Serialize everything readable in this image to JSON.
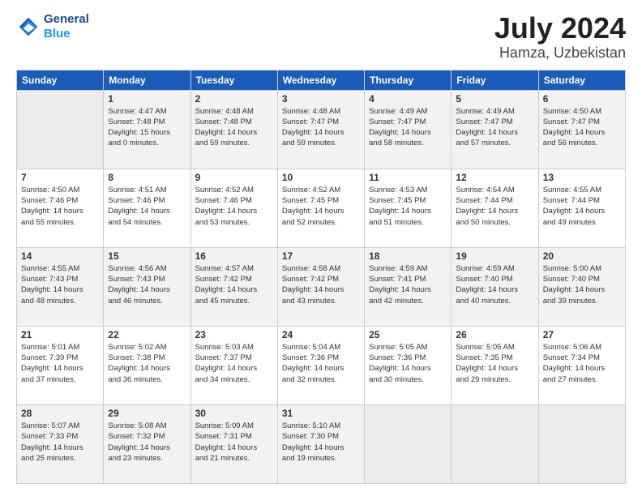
{
  "header": {
    "logo_line1": "General",
    "logo_line2": "Blue",
    "month": "July 2024",
    "location": "Hamza, Uzbekistan"
  },
  "weekdays": [
    "Sunday",
    "Monday",
    "Tuesday",
    "Wednesday",
    "Thursday",
    "Friday",
    "Saturday"
  ],
  "rows": [
    [
      {
        "day": "",
        "info": ""
      },
      {
        "day": "1",
        "info": "Sunrise: 4:47 AM\nSunset: 7:48 PM\nDaylight: 15 hours\nand 0 minutes."
      },
      {
        "day": "2",
        "info": "Sunrise: 4:48 AM\nSunset: 7:48 PM\nDaylight: 14 hours\nand 59 minutes."
      },
      {
        "day": "3",
        "info": "Sunrise: 4:48 AM\nSunset: 7:47 PM\nDaylight: 14 hours\nand 59 minutes."
      },
      {
        "day": "4",
        "info": "Sunrise: 4:49 AM\nSunset: 7:47 PM\nDaylight: 14 hours\nand 58 minutes."
      },
      {
        "day": "5",
        "info": "Sunrise: 4:49 AM\nSunset: 7:47 PM\nDaylight: 14 hours\nand 57 minutes."
      },
      {
        "day": "6",
        "info": "Sunrise: 4:50 AM\nSunset: 7:47 PM\nDaylight: 14 hours\nand 56 minutes."
      }
    ],
    [
      {
        "day": "7",
        "info": "Sunrise: 4:50 AM\nSunset: 7:46 PM\nDaylight: 14 hours\nand 55 minutes."
      },
      {
        "day": "8",
        "info": "Sunrise: 4:51 AM\nSunset: 7:46 PM\nDaylight: 14 hours\nand 54 minutes."
      },
      {
        "day": "9",
        "info": "Sunrise: 4:52 AM\nSunset: 7:46 PM\nDaylight: 14 hours\nand 53 minutes."
      },
      {
        "day": "10",
        "info": "Sunrise: 4:52 AM\nSunset: 7:45 PM\nDaylight: 14 hours\nand 52 minutes."
      },
      {
        "day": "11",
        "info": "Sunrise: 4:53 AM\nSunset: 7:45 PM\nDaylight: 14 hours\nand 51 minutes."
      },
      {
        "day": "12",
        "info": "Sunrise: 4:54 AM\nSunset: 7:44 PM\nDaylight: 14 hours\nand 50 minutes."
      },
      {
        "day": "13",
        "info": "Sunrise: 4:55 AM\nSunset: 7:44 PM\nDaylight: 14 hours\nand 49 minutes."
      }
    ],
    [
      {
        "day": "14",
        "info": "Sunrise: 4:55 AM\nSunset: 7:43 PM\nDaylight: 14 hours\nand 48 minutes."
      },
      {
        "day": "15",
        "info": "Sunrise: 4:56 AM\nSunset: 7:43 PM\nDaylight: 14 hours\nand 46 minutes."
      },
      {
        "day": "16",
        "info": "Sunrise: 4:57 AM\nSunset: 7:42 PM\nDaylight: 14 hours\nand 45 minutes."
      },
      {
        "day": "17",
        "info": "Sunrise: 4:58 AM\nSunset: 7:42 PM\nDaylight: 14 hours\nand 43 minutes."
      },
      {
        "day": "18",
        "info": "Sunrise: 4:59 AM\nSunset: 7:41 PM\nDaylight: 14 hours\nand 42 minutes."
      },
      {
        "day": "19",
        "info": "Sunrise: 4:59 AM\nSunset: 7:40 PM\nDaylight: 14 hours\nand 40 minutes."
      },
      {
        "day": "20",
        "info": "Sunrise: 5:00 AM\nSunset: 7:40 PM\nDaylight: 14 hours\nand 39 minutes."
      }
    ],
    [
      {
        "day": "21",
        "info": "Sunrise: 5:01 AM\nSunset: 7:39 PM\nDaylight: 14 hours\nand 37 minutes."
      },
      {
        "day": "22",
        "info": "Sunrise: 5:02 AM\nSunset: 7:38 PM\nDaylight: 14 hours\nand 36 minutes."
      },
      {
        "day": "23",
        "info": "Sunrise: 5:03 AM\nSunset: 7:37 PM\nDaylight: 14 hours\nand 34 minutes."
      },
      {
        "day": "24",
        "info": "Sunrise: 5:04 AM\nSunset: 7:36 PM\nDaylight: 14 hours\nand 32 minutes."
      },
      {
        "day": "25",
        "info": "Sunrise: 5:05 AM\nSunset: 7:36 PM\nDaylight: 14 hours\nand 30 minutes."
      },
      {
        "day": "26",
        "info": "Sunrise: 5:05 AM\nSunset: 7:35 PM\nDaylight: 14 hours\nand 29 minutes."
      },
      {
        "day": "27",
        "info": "Sunrise: 5:06 AM\nSunset: 7:34 PM\nDaylight: 14 hours\nand 27 minutes."
      }
    ],
    [
      {
        "day": "28",
        "info": "Sunrise: 5:07 AM\nSunset: 7:33 PM\nDaylight: 14 hours\nand 25 minutes."
      },
      {
        "day": "29",
        "info": "Sunrise: 5:08 AM\nSunset: 7:32 PM\nDaylight: 14 hours\nand 23 minutes."
      },
      {
        "day": "30",
        "info": "Sunrise: 5:09 AM\nSunset: 7:31 PM\nDaylight: 14 hours\nand 21 minutes."
      },
      {
        "day": "31",
        "info": "Sunrise: 5:10 AM\nSunset: 7:30 PM\nDaylight: 14 hours\nand 19 minutes."
      },
      {
        "day": "",
        "info": ""
      },
      {
        "day": "",
        "info": ""
      },
      {
        "day": "",
        "info": ""
      }
    ]
  ]
}
